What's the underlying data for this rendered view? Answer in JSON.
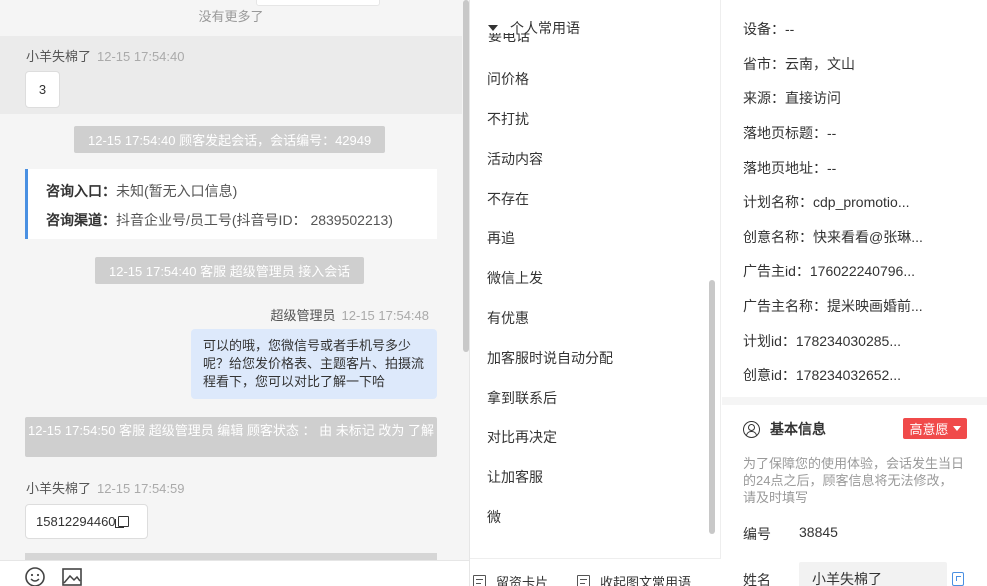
{
  "chat": {
    "no_more": "没有更多了",
    "msg1": {
      "sender": "小羊失棉了",
      "time": "12-15 17:54:40",
      "text": "3"
    },
    "sys1": "12-15 17:54:40 顾客发起会话，会话编号：42949",
    "consult": {
      "entry_label": "咨询入口：",
      "entry_value": "未知(暂无入口信息)",
      "channel_label": "咨询渠道：",
      "channel_value": "抖音企业号/员工号(抖音号ID： 2839502213)"
    },
    "sys2": "12-15 17:54:40 客服 超级管理员 接入会话",
    "agent_msg": {
      "sender": "超级管理员",
      "time": "12-15 17:54:48",
      "text": "可以的哦，您微信号或者手机号多少呢？给您发价格表、主题客片、拍摄流程看下，您可以对比了解一下哈"
    },
    "sys3": "12-15 17:54:50 客服 超级管理员 编辑 顾客状态 ： 由 未标记 改为 了解",
    "msg2": {
      "sender": "小羊失棉了",
      "time": "12-15 17:54:59",
      "text": "15812294460"
    }
  },
  "toolbar": {
    "emoji_icon": "smiley-icon",
    "image_icon": "image-icon"
  },
  "phrases": {
    "group_label": "个人常用语",
    "cut_item": "要电话",
    "items": [
      "问价格",
      "不打扰",
      "活动内容",
      "不存在",
      "再追",
      "微信上发",
      "有优惠",
      "加客服时说自动分配",
      "拿到联系后",
      "对比再决定",
      "让加客服",
      "微"
    ],
    "btn_card": "留资卡片",
    "btn_collapse": "收起图文常用语"
  },
  "info": {
    "rows": [
      "设备：--",
      "省市：云南，文山",
      "来源：直接访问",
      "落地页标题：--",
      "落地页地址：--",
      "计划名称：cdp_promotio...",
      "创意名称：快来看看@张琳...",
      "广告主id：176022240796...",
      "广告主名称：提米映画婚前...",
      "计划id：178234030285...",
      "创意id：178234032652..."
    ],
    "basic_title": "基本信息",
    "intent": "高意愿",
    "notice": "为了保障您的使用体验，会话发生当日的24点之后，顾客信息将无法修改，请及时填写",
    "id_label": "编号",
    "id_value": "38845",
    "name_label": "姓名",
    "name_value": "小羊失棉了"
  }
}
